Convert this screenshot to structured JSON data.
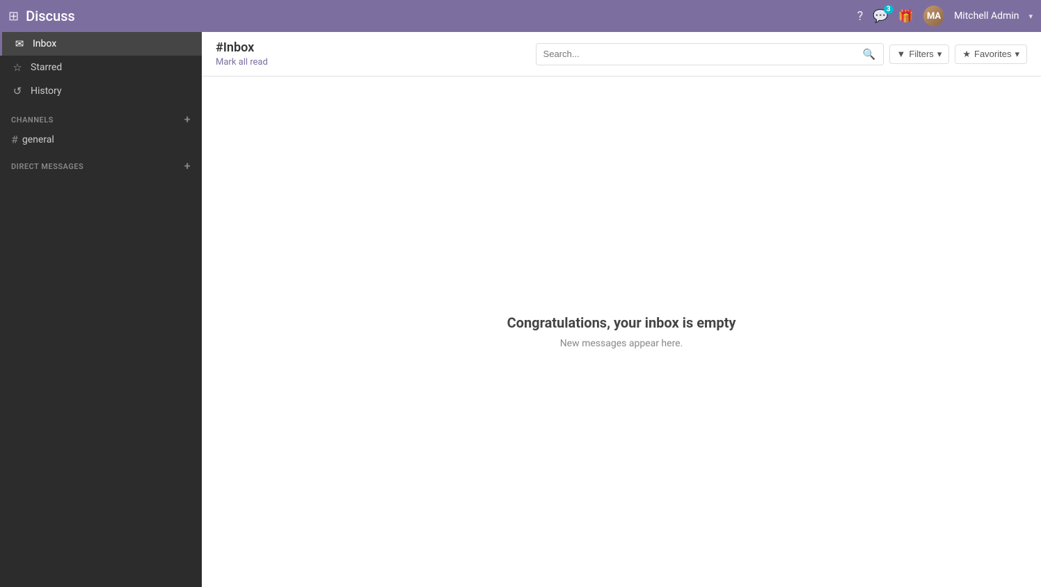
{
  "topnav": {
    "title": "Discuss",
    "chat_badge": "3",
    "username": "Mitchell Admin",
    "dropdown_arrow": "▾"
  },
  "header": {
    "page_title": "#Inbox",
    "mark_all_read": "Mark all read",
    "search_placeholder": "Search...",
    "search_icon": "🔍",
    "filters_label": "Filters",
    "favorites_label": "Favorites"
  },
  "sidebar": {
    "nav_items": [
      {
        "id": "inbox",
        "icon": "✉",
        "label": "Inbox",
        "active": true
      },
      {
        "id": "starred",
        "icon": "☆",
        "label": "Starred",
        "active": false
      },
      {
        "id": "history",
        "icon": "↺",
        "label": "History",
        "active": false
      }
    ],
    "channels_section_label": "CHANNELS",
    "channels": [
      {
        "id": "general",
        "label": "general"
      }
    ],
    "direct_messages_section_label": "DIRECT MESSAGES"
  },
  "main": {
    "empty_title": "Congratulations, your inbox is empty",
    "empty_subtitle": "New messages appear here."
  }
}
